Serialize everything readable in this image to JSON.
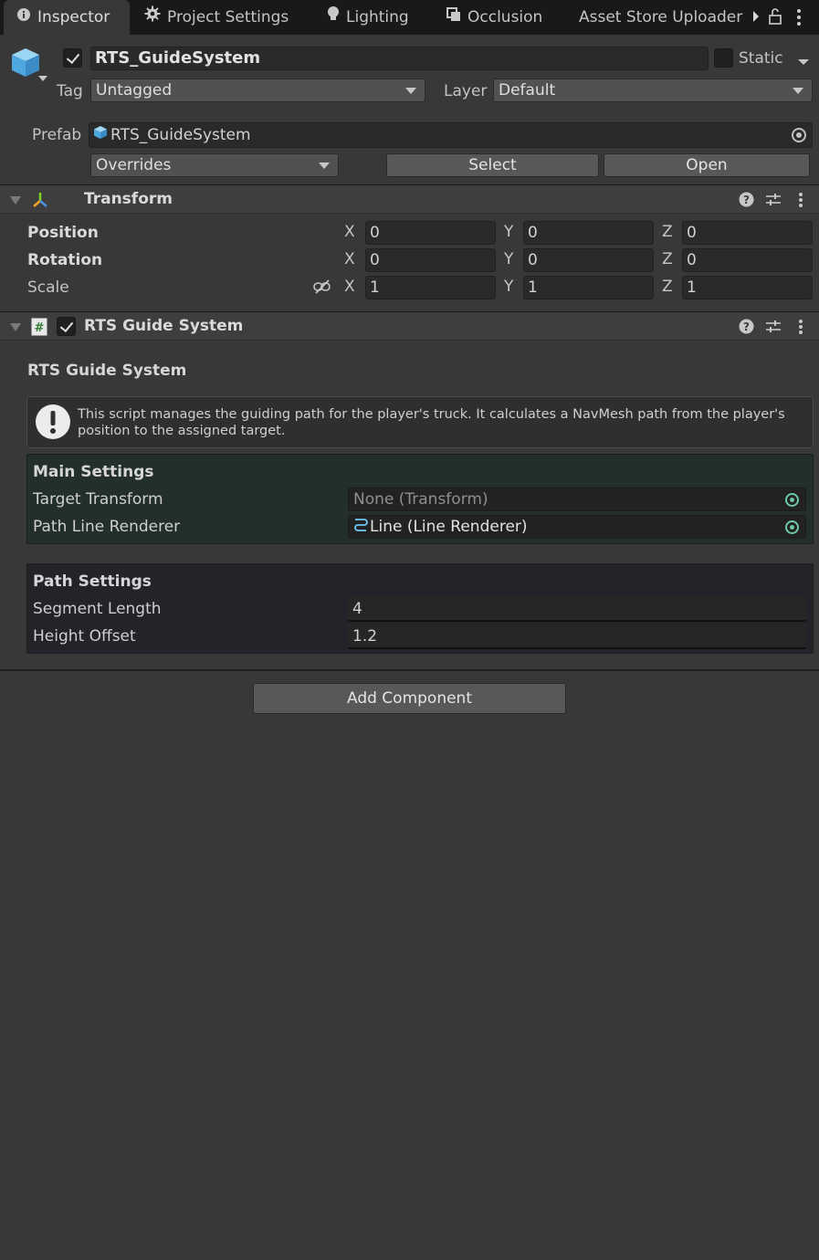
{
  "tabs": [
    {
      "label": "Inspector",
      "icon": "info-icon",
      "active": true
    },
    {
      "label": "Project Settings",
      "icon": "gear-icon",
      "active": false
    },
    {
      "label": "Lighting",
      "icon": "lightbulb-icon",
      "active": false
    },
    {
      "label": "Occlusion",
      "icon": "occlusion-icon",
      "active": false
    },
    {
      "label": "Asset Store Uploader",
      "icon": "",
      "active": false
    }
  ],
  "header": {
    "object_name": "RTS_GuideSystem",
    "active": true,
    "static_label": "Static",
    "static_checked": false,
    "tag_label": "Tag",
    "tag_value": "Untagged",
    "layer_label": "Layer",
    "layer_value": "Default",
    "prefab_label": "Prefab",
    "prefab_value": "RTS_GuideSystem",
    "overrides_value": "Overrides",
    "select_label": "Select",
    "open_label": "Open"
  },
  "transform": {
    "title": "Transform",
    "rows": [
      {
        "label": "Position",
        "x": "0",
        "y": "0",
        "z": "0"
      },
      {
        "label": "Rotation",
        "x": "0",
        "y": "0",
        "z": "0"
      },
      {
        "label": "Scale",
        "x": "1",
        "y": "1",
        "z": "1"
      }
    ],
    "axes": [
      "X",
      "Y",
      "Z"
    ]
  },
  "script": {
    "title": "RTS Guide System",
    "enabled": true,
    "heading": "RTS Guide System",
    "help_text_line1": "This script manages the guiding path for the player's truck. It calculates a NavMesh path from the player's",
    "help_text_line2": "position to the assigned target.",
    "main_settings": {
      "title": "Main Settings",
      "target_label": "Target Transform",
      "target_value": "None (Transform)",
      "line_label": "Path Line Renderer",
      "line_value": "Line (Line Renderer)"
    },
    "path_settings": {
      "title": "Path Settings",
      "segment_label": "Segment Length",
      "segment_value": "4",
      "height_label": "Height Offset",
      "height_value": "1.2"
    }
  },
  "add_component_label": "Add Component",
  "colors": {
    "background": "#383838",
    "tabbar": "#191919",
    "field": "#2a2a2a",
    "main_settings_bg": "#233029",
    "path_settings_bg": "#23232a",
    "accent": "#6cc9a3"
  }
}
